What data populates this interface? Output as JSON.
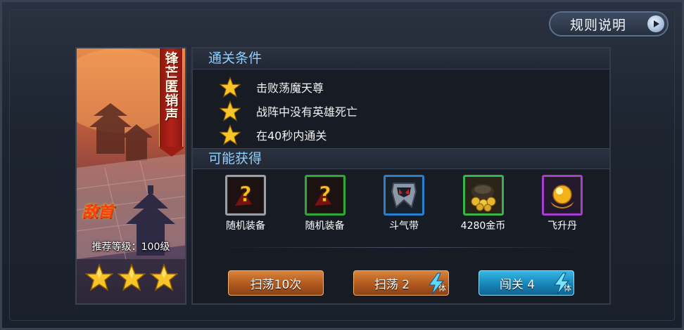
{
  "header": {
    "rule_button_label": "规则说明"
  },
  "stage": {
    "banner_title": "锋芒匿销声",
    "boss_tag": "敌首",
    "recommended_level": "推荐等级：100级",
    "star_count": 3
  },
  "conditions": {
    "title": "通关条件",
    "items": [
      {
        "text": "击败荡魔天尊"
      },
      {
        "text": "战阵中没有英雄死亡"
      },
      {
        "text": "在40秒内通关"
      }
    ]
  },
  "rewards": {
    "title": "可能获得",
    "items": [
      {
        "label": "随机装备",
        "icon": "random-equipment-icon",
        "rarity_color": "#9aa0a6"
      },
      {
        "label": "随机装备",
        "icon": "random-equipment-icon",
        "rarity_color": "#2fa83a"
      },
      {
        "label": "斗气带",
        "icon": "belt-icon",
        "rarity_color": "#2a7fd1"
      },
      {
        "label": "4280金币",
        "icon": "gold-coins-icon",
        "rarity_color": "#38b54a"
      },
      {
        "label": "飞升丹",
        "icon": "pill-icon",
        "rarity_color": "#a43fd0"
      }
    ]
  },
  "actions": {
    "sweep10_label": "扫荡10次",
    "sweep_label": "扫荡 2",
    "challenge_label": "闯关 4",
    "energy_suffix": "体"
  }
}
